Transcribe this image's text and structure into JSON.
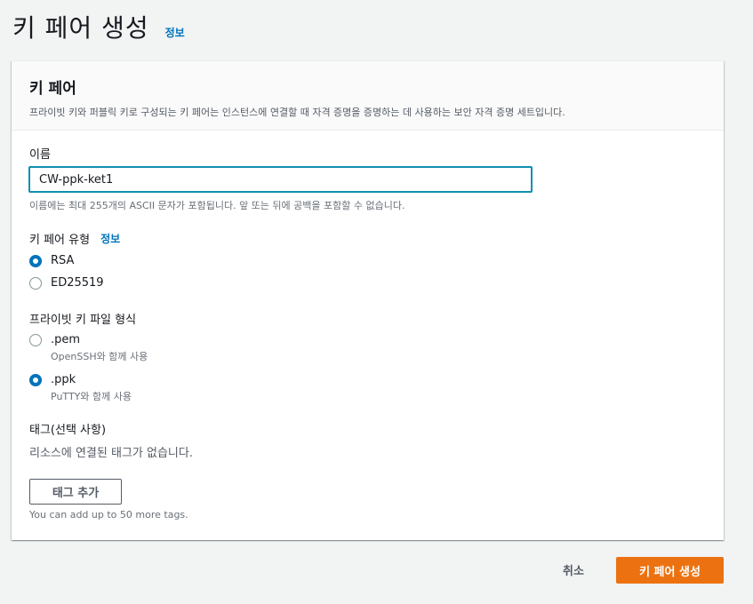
{
  "page": {
    "title": "키 페어 생성",
    "info_label": "정보"
  },
  "panel": {
    "title": "키 페어",
    "description": "프라이빗 키와 퍼블릭 키로 구성되는 키 페어는 인스턴스에 연결할 때 자격 증명을 증명하는 데 사용하는 보안 자격 증명 세트입니다."
  },
  "name_field": {
    "label": "이름",
    "value": "CW-ppk-ket1",
    "hint": "이름에는 최대 255개의 ASCII 문자가 포함됩니다. 앞 또는 뒤에 공백을 포함할 수 없습니다."
  },
  "key_type": {
    "label": "키 페어 유형",
    "info_label": "정보",
    "options": [
      {
        "label": "RSA",
        "selected": true
      },
      {
        "label": "ED25519",
        "selected": false
      }
    ]
  },
  "file_format": {
    "label": "프라이빗 키 파일 형식",
    "options": [
      {
        "label": ".pem",
        "description": "OpenSSH와 함께 사용",
        "selected": false
      },
      {
        "label": ".ppk",
        "description": "PuTTY와 함께 사용",
        "selected": true
      }
    ]
  },
  "tags": {
    "label": "태그(선택 사항)",
    "empty_text": "리소스에 연결된 태그가 없습니다.",
    "add_button": "태그 추가",
    "limit_text": "You can add up to 50 more tags."
  },
  "footer": {
    "cancel_label": "취소",
    "submit_label": "키 페어 생성"
  },
  "colors": {
    "accent": "#0073bb",
    "primary_button": "#ec7211",
    "input_focus": "#0f8fb0"
  }
}
